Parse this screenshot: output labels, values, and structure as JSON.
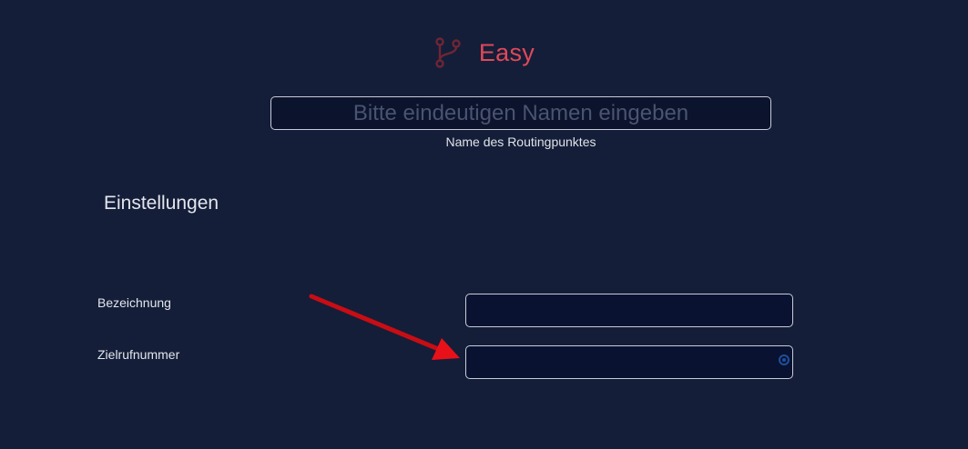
{
  "header": {
    "title": "Easy",
    "logo_icon": "git-branch-icon",
    "accent_color": "#e0485a"
  },
  "name_field": {
    "placeholder": "Bitte eindeutigen Namen eingeben",
    "value": "",
    "caption": "Name des Routingpunktes"
  },
  "settings": {
    "title": "Einstellungen",
    "fields": [
      {
        "label": "Bezeichnung",
        "value": ""
      },
      {
        "label": "Zielrufnummer",
        "value": "",
        "indicator_icon": "radio-dot-icon"
      }
    ]
  },
  "annotation": {
    "arrow_icon": "red-arrow-annotation",
    "arrow_color": "#e8111a"
  }
}
